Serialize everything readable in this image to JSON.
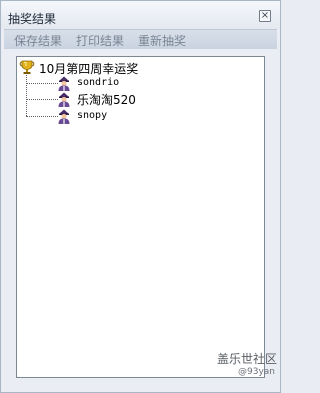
{
  "window": {
    "title": "抽奖结果",
    "close_glyph": "×"
  },
  "toolbar": {
    "save_label": "保存结果",
    "print_label": "打印结果",
    "redraw_label": "重新抽奖"
  },
  "tree": {
    "root_label": "10月第四周幸运奖",
    "root_icon": "trophy-icon",
    "children": [
      {
        "label": "sondrio",
        "icon": "user-icon"
      },
      {
        "label": "乐淘淘520",
        "icon": "user-icon"
      },
      {
        "label": "snopy",
        "icon": "user-icon"
      }
    ]
  },
  "watermark": {
    "site": "盖乐世社区",
    "handle": "@93yan"
  },
  "colors": {
    "window_bg": "#eaeef4",
    "toolbar_text_disabled": "#7a8594",
    "tree_bg": "#ffffff"
  }
}
